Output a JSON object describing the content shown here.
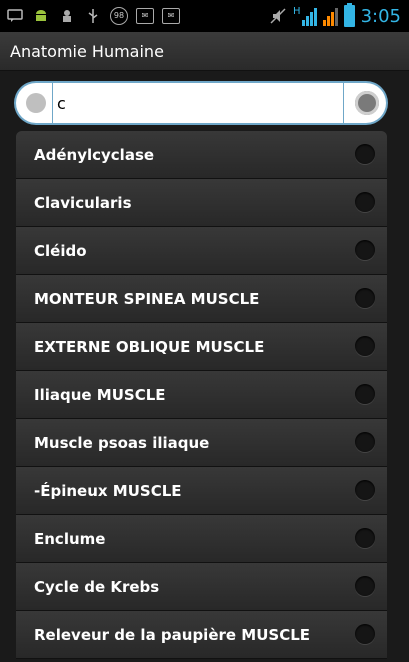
{
  "status_bar": {
    "time": "3:05",
    "network_label": "H",
    "icons": [
      "message-icon",
      "android-icon",
      "usb-debug-icon",
      "usb-icon",
      "counter-icon",
      "message-icon",
      "message-icon",
      "mute-icon",
      "signal-icon",
      "battery-icon"
    ],
    "counter_badge": "98"
  },
  "app": {
    "title": "Anatomie Humaine"
  },
  "search": {
    "value": "c"
  },
  "items": [
    {
      "label": "Adénylcyclase"
    },
    {
      "label": "Clavicularis"
    },
    {
      "label": "Cléido"
    },
    {
      "label": "MONTEUR SPINEA MUSCLE"
    },
    {
      "label": "EXTERNE OBLIQUE MUSCLE"
    },
    {
      "label": "Iliaque MUSCLE"
    },
    {
      "label": "Muscle psoas iliaque"
    },
    {
      "label": "-Épineux MUSCLE"
    },
    {
      "label": "Enclume"
    },
    {
      "label": "Cycle de Krebs"
    },
    {
      "label": "Releveur de la paupière MUSCLE"
    }
  ],
  "colors": {
    "accent": "#33b5e5",
    "background": "#1a1a1a",
    "row": "#303030"
  }
}
